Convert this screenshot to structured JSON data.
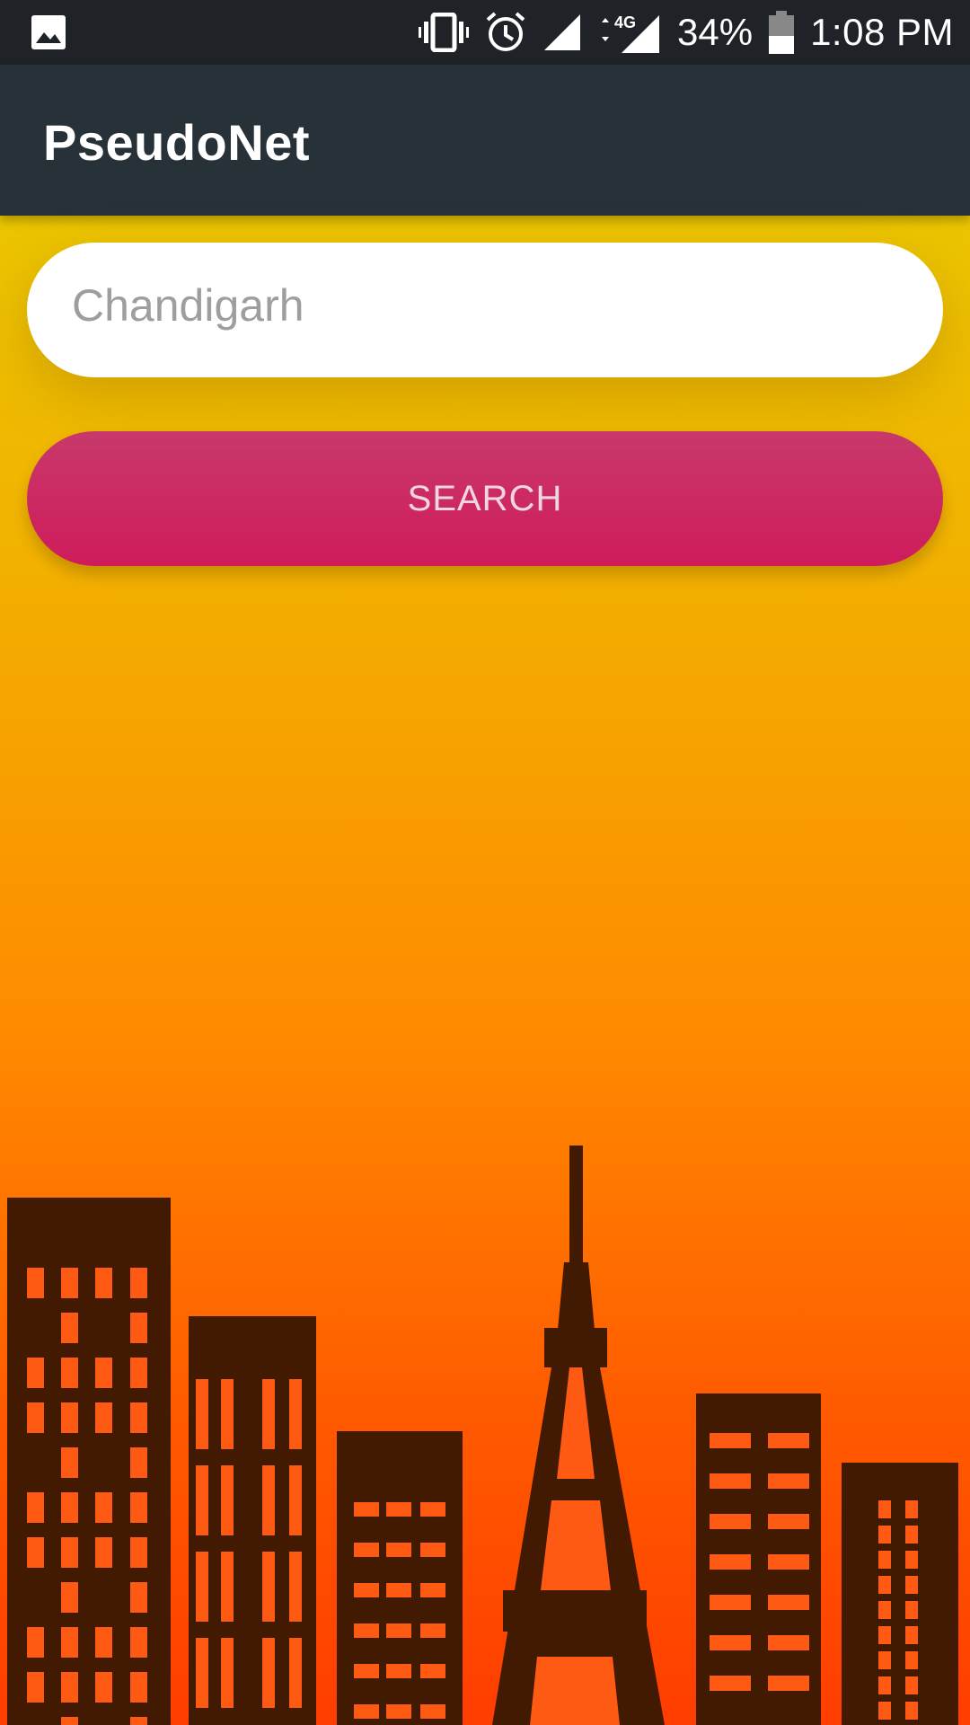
{
  "status_bar": {
    "battery_percent": "34%",
    "time": "1:08 PM",
    "network": "4G",
    "icons": [
      "image-icon",
      "vibrate-icon",
      "alarm-icon",
      "signal-icon",
      "data-arrows-icon",
      "signal-4g-icon",
      "battery-icon"
    ]
  },
  "app_bar": {
    "title": "PseudoNet"
  },
  "search": {
    "placeholder": "Chandigarh",
    "value": ""
  },
  "search_button": {
    "label": "SEARCH"
  },
  "colors": {
    "app_bar": "#263238",
    "status_bar": "#1f2327",
    "button": "#cf1b5c",
    "skyline": "#421a02",
    "windows": "#ff5a14"
  }
}
